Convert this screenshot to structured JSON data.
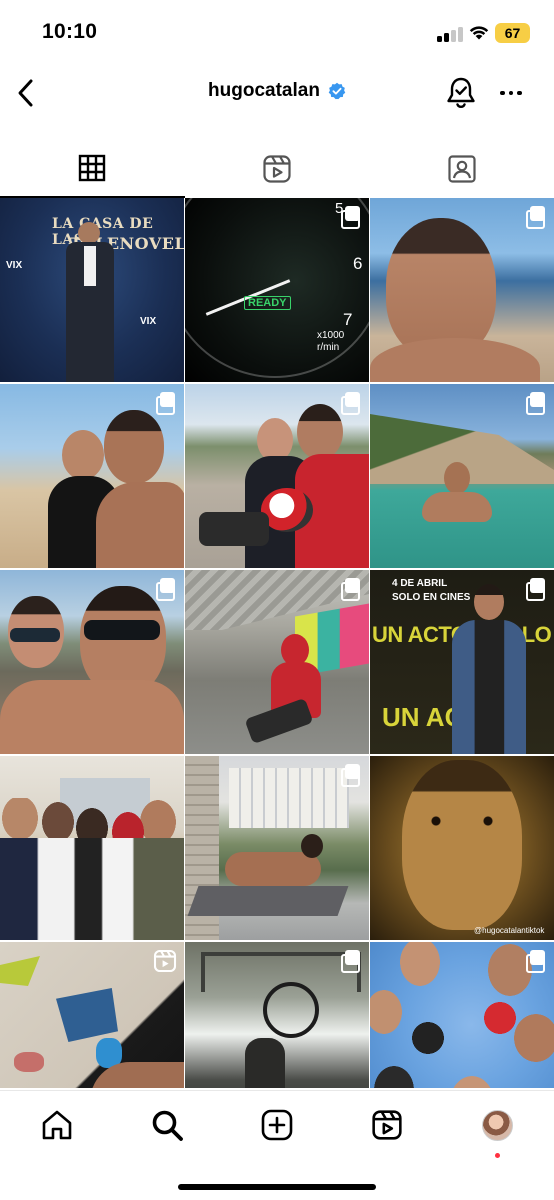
{
  "status_bar": {
    "time": "10:10",
    "battery": "67",
    "battery_color": "#f7ce45"
  },
  "header": {
    "username": "hugocatalan",
    "verified": true,
    "verified_color": "#3897f0",
    "back_icon": "chevron-left-icon",
    "bell_icon": "bell-check-icon",
    "more_icon": "more-horizontal-icon"
  },
  "tabs": [
    {
      "name": "posts",
      "icon": "grid-icon",
      "active": true
    },
    {
      "name": "reels",
      "icon": "reels-icon",
      "active": false
    },
    {
      "name": "tagged",
      "icon": "tagged-icon",
      "active": false
    }
  ],
  "posts": [
    {
      "id": "p1",
      "badge": "none",
      "caption": "LA CASA DE LAS TELENOVELAS"
    },
    {
      "id": "p2",
      "badge": "multi",
      "caption": "READY"
    },
    {
      "id": "p3",
      "badge": "multi"
    },
    {
      "id": "p4",
      "badge": "multi"
    },
    {
      "id": "p5",
      "badge": "multi"
    },
    {
      "id": "p6",
      "badge": "multi"
    },
    {
      "id": "p7",
      "badge": "multi"
    },
    {
      "id": "p8",
      "badge": "multi"
    },
    {
      "id": "p9",
      "badge": "multi",
      "caption": "UN ACTOR MALO"
    },
    {
      "id": "p10",
      "badge": "none"
    },
    {
      "id": "p11",
      "badge": "multi"
    },
    {
      "id": "p12",
      "badge": "none",
      "caption": "@hugocatalantiktok"
    },
    {
      "id": "p13",
      "badge": "reel"
    },
    {
      "id": "p14",
      "badge": "multi"
    },
    {
      "id": "p15",
      "badge": "multi"
    }
  ],
  "post_text": {
    "p1_title_1": "LA CASA DE LAS",
    "p1_title_2": "TELENOVELAS",
    "p1_vix": "VIX",
    "p2_ready": "READY",
    "p2_gauge_unit": "x1000 r/min",
    "p2_tick_7": "7",
    "p2_tick_6": "6",
    "p2_tick_5": "5",
    "p9_date": "4 DE ABRIL",
    "p9_cinemas": "SOLO EN CINES",
    "p9_big": "UN ACTOR MALO",
    "p9_big2": "UN ACTO",
    "p12_handle": "@hugocatalantiktok"
  },
  "bottom_nav": [
    {
      "name": "home",
      "icon": "home-icon"
    },
    {
      "name": "search",
      "icon": "search-icon"
    },
    {
      "name": "create",
      "icon": "plus-square-icon"
    },
    {
      "name": "reels",
      "icon": "reels-icon"
    },
    {
      "name": "profile",
      "icon": "avatar"
    }
  ],
  "colors": {
    "notification_dot": "#ff3040"
  }
}
